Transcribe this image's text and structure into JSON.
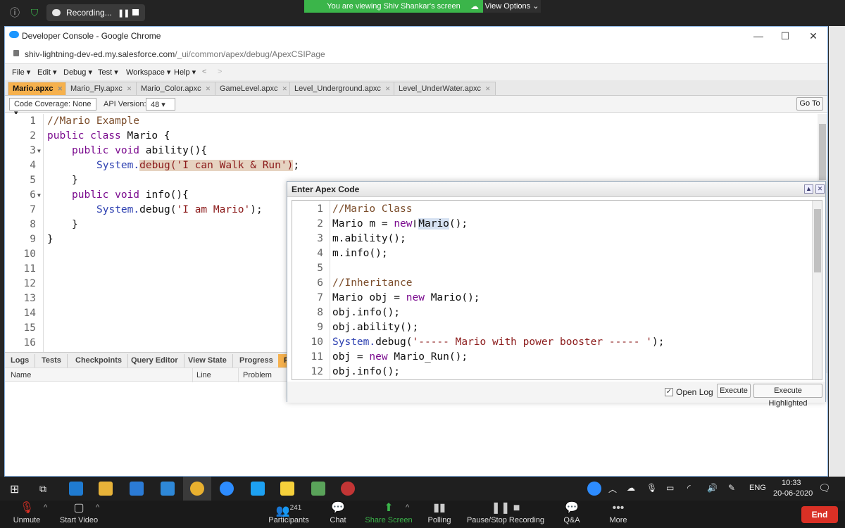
{
  "zoom_top": {
    "recording_label": "Recording...",
    "viewing_banner": "You are viewing Shiv Shankar's screen",
    "view_options": "View Options"
  },
  "chrome": {
    "window_title": "Developer Console - Google Chrome",
    "url_host": "shiv-lightning-dev-ed.my.salesforce.com",
    "url_path": "/_ui/common/apex/debug/ApexCSIPage"
  },
  "menu": [
    "File",
    "Edit",
    "Debug",
    "Test",
    "Workspace",
    "Help"
  ],
  "file_tabs": [
    "Mario.apxc",
    "Mario_Fly.apxc",
    "Mario_Color.apxc",
    "GameLevel.apxc",
    "Level_Underground.apxc",
    "Level_UnderWater.apxc"
  ],
  "toolbar": {
    "coverage": "Code Coverage: None",
    "api_label": "API Version:",
    "api_value": "48",
    "goto": "Go To"
  },
  "main_code": {
    "line_numbers": [
      "1",
      "2",
      "3",
      "4",
      "5",
      "6",
      "7",
      "8",
      "9",
      "10",
      "11",
      "12",
      "13",
      "14",
      "15",
      "16"
    ],
    "l1": "//Mario Example",
    "l2_kw": "public class",
    "l2_rest": " Mario {",
    "l3_kw": "public void",
    "l3_rest": " ability(){",
    "l4_sys": "System.",
    "l4_hl": "debug('I can Walk & Run')",
    "l4_end": ";",
    "l5": "}",
    "l6_kw": "public void",
    "l6_rest": " info(){",
    "l7_sys": "System.",
    "l7_rest": "debug(",
    "l7_str": "'I am Mario'",
    "l7_end": ");",
    "l8": "}",
    "l9": "}"
  },
  "bottom_tabs": [
    "Logs",
    "Tests",
    "Checkpoints",
    "Query Editor",
    "View State",
    "Progress",
    "P"
  ],
  "problems_columns": [
    "Name",
    "Line",
    "Problem"
  ],
  "dialog": {
    "title": "Enter Apex Code",
    "line_numbers": [
      "1",
      "2",
      "3",
      "4",
      "5",
      "6",
      "7",
      "8",
      "9",
      "10",
      "11",
      "12"
    ],
    "d1": "//Mario Class",
    "d2_a": "Mario m = ",
    "d2_kw": "new",
    "d2_hl": "Mario",
    "d2_end": "();",
    "d3": "m.ability();",
    "d4": "m.info();",
    "d6": "//Inheritance",
    "d7_a": "Mario obj = ",
    "d7_kw": "new",
    "d7_end": " Mario();",
    "d8": "obj.info();",
    "d9": "obj.ability();",
    "d10_sys": "System.",
    "d10_a": "debug(",
    "d10_str": "'----- Mario with power booster ----- '",
    "d10_end": ");",
    "d11_a": "obj = ",
    "d11_kw": "new",
    "d11_end": " Mario_Run();",
    "d12": "obj.info();",
    "open_log": "Open Log",
    "execute": "Execute",
    "execute_highlighted": "Execute Highlighted"
  },
  "system_tray": {
    "lang": "ENG",
    "time": "10:33",
    "date": "20-06-2020"
  },
  "zoom_bottom": {
    "unmute": "Unmute",
    "start_video": "Start Video",
    "participants": "Participants",
    "participants_count": "241",
    "chat": "Chat",
    "share_screen": "Share Screen",
    "polling": "Polling",
    "pause_stop": "Pause/Stop Recording",
    "qa": "Q&A",
    "more": "More",
    "end": "End"
  },
  "colors": {
    "active_tab": "#f6b14d",
    "zoom_green": "#3bb54a",
    "end_red": "#d93025",
    "keyword": "#7a0a8e",
    "comment": "#7b4d2b",
    "string": "#8b1a1a"
  }
}
